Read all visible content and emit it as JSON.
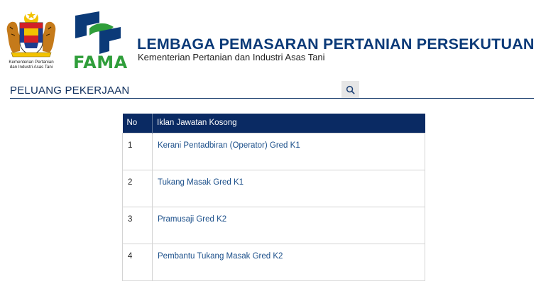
{
  "header": {
    "crest_caption_line1": "Kementerian Pertanian",
    "crest_caption_line2": "dan Industri Asas Tani",
    "fama_logo_text": "FAMA",
    "org_title": "LEMBAGA PEMASARAN PERTANIAN PERSEKUTUAN",
    "org_subtitle": "Kementerian Pertanian dan Industri Asas Tani"
  },
  "section": {
    "title": "PELUANG PEKERJAAN",
    "search_icon": "search-icon"
  },
  "table": {
    "headers": [
      "No",
      "Iklan Jawatan Kosong"
    ],
    "rows": [
      {
        "no": "1",
        "title": "Kerani Pentadbiran (Operator) Gred K1"
      },
      {
        "no": "2",
        "title": "Tukang Masak Gred K1"
      },
      {
        "no": "3",
        "title": "Pramusaji Gred K2"
      },
      {
        "no": "4",
        "title": "Pembantu Tukang Masak Gred K2"
      }
    ]
  },
  "colors": {
    "brand_navy": "#0b3a78",
    "table_header": "#0a2a63",
    "fama_green": "#2f9e3a",
    "link": "#1b4f8a"
  }
}
